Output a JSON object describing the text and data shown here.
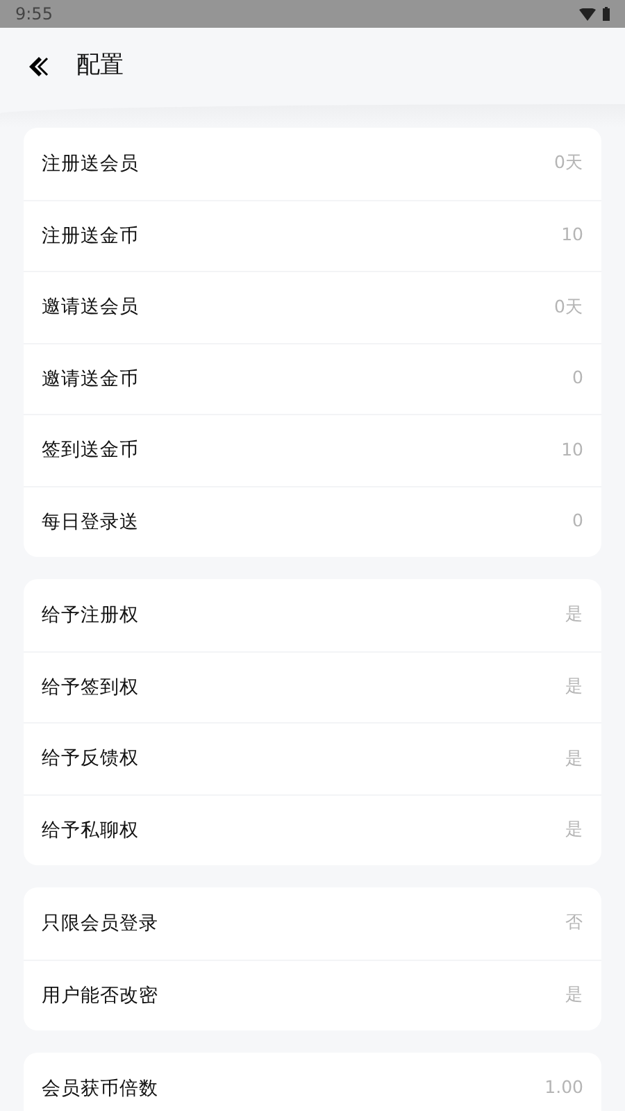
{
  "status_bar": {
    "time": "9:55"
  },
  "header": {
    "title": "配置"
  },
  "groups": [
    {
      "rows": [
        {
          "label": "注册送会员",
          "value": "0天"
        },
        {
          "label": "注册送金币",
          "value": "10"
        },
        {
          "label": "邀请送会员",
          "value": "0天"
        },
        {
          "label": "邀请送金币",
          "value": "0"
        },
        {
          "label": "签到送金币",
          "value": "10"
        },
        {
          "label": "每日登录送",
          "value": "0"
        }
      ]
    },
    {
      "rows": [
        {
          "label": "给予注册权",
          "value": "是"
        },
        {
          "label": "给予签到权",
          "value": "是"
        },
        {
          "label": "给予反馈权",
          "value": "是"
        },
        {
          "label": "给予私聊权",
          "value": "是"
        }
      ]
    },
    {
      "rows": [
        {
          "label": "只限会员登录",
          "value": "否"
        },
        {
          "label": "用户能否改密",
          "value": "是"
        }
      ]
    },
    {
      "rows": [
        {
          "label": "会员获币倍数",
          "value": "1.00"
        }
      ]
    }
  ]
}
